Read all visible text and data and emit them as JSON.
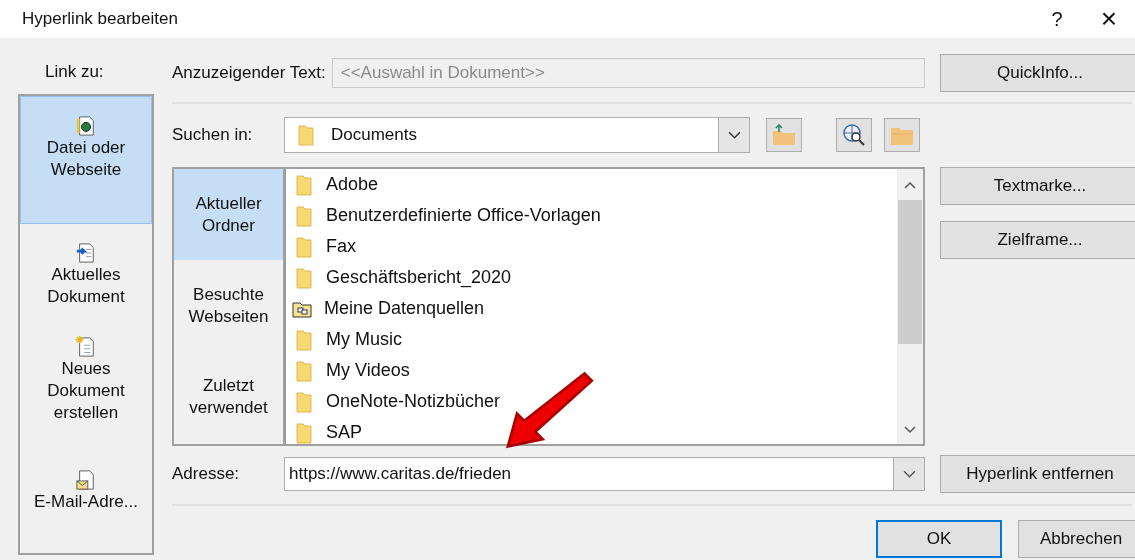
{
  "window": {
    "title": "Hyperlink bearbeiten",
    "help": "?",
    "close": "×"
  },
  "link_to": {
    "label": "Link zu:",
    "items": [
      {
        "label": "Datei oder Webseite",
        "kind": "file",
        "selected": true
      },
      {
        "label": "Aktuelles Dokument",
        "kind": "current",
        "selected": false
      },
      {
        "label": "Neues Dokument erstellen",
        "kind": "new",
        "selected": false
      },
      {
        "label": "E-Mail-Adre...",
        "kind": "mail",
        "selected": false
      }
    ]
  },
  "display_text": {
    "label": "Anzuzeigender Text:",
    "value": "<<Auswahl in Dokument>>"
  },
  "quickinfo_button": "QuickInfo...",
  "look_in": {
    "label": "Suchen in:",
    "value": "Documents"
  },
  "browse_nav": [
    {
      "label": "Aktueller Ordner",
      "selected": true
    },
    {
      "label": "Besuchte Webseiten",
      "selected": false
    },
    {
      "label": "Zuletzt verwendet",
      "selected": false
    }
  ],
  "files": [
    {
      "name": "Adobe",
      "kind": "folder"
    },
    {
      "name": "Benutzerdefinierte Office-Vorlagen",
      "kind": "folder"
    },
    {
      "name": "Fax",
      "kind": "folder"
    },
    {
      "name": "Geschäftsbericht_2020",
      "kind": "folder"
    },
    {
      "name": "Meine Datenquellen",
      "kind": "datasource"
    },
    {
      "name": "My Music",
      "kind": "folder"
    },
    {
      "name": "My Videos",
      "kind": "folder"
    },
    {
      "name": "OneNote-Notizbücher",
      "kind": "folder"
    },
    {
      "name": "SAP",
      "kind": "folder"
    }
  ],
  "side_buttons": [
    "Textmarke...",
    "Zielframe..."
  ],
  "address": {
    "label": "Adresse:",
    "value": "https://www.caritas.de/frieden"
  },
  "remove_button": "Hyperlink entfernen",
  "buttons": [
    "OK",
    "Abbrechen"
  ]
}
